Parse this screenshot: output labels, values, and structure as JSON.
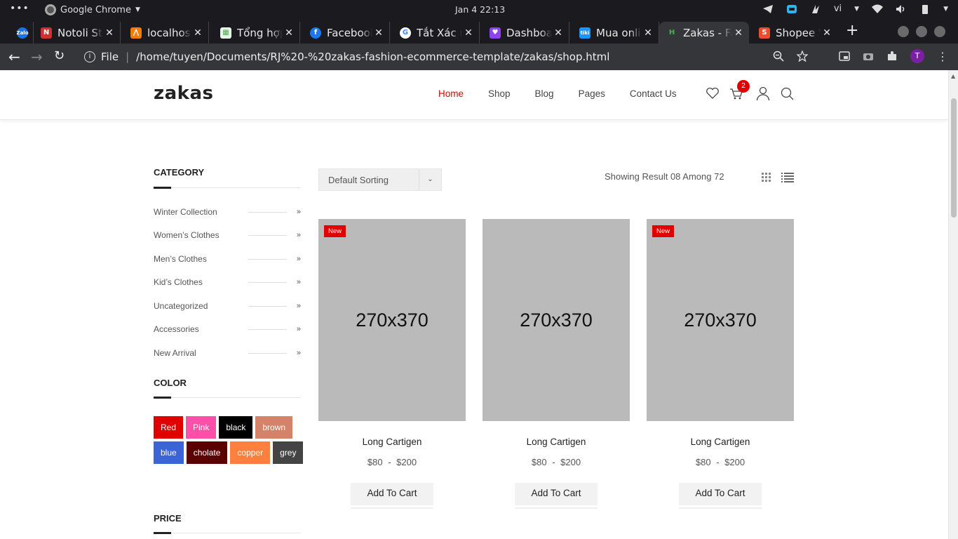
{
  "os": {
    "app_name": "Google Chrome",
    "clock": "Jan 4  22:13",
    "keyboard": "vi"
  },
  "tabs": [
    {
      "title": "",
      "favicon": "zalo-icon",
      "color": "#1a73e8"
    },
    {
      "title": "Notoli St",
      "favicon": "N",
      "color": "#d32f2f"
    },
    {
      "title": "localhost",
      "favicon": "xampp-icon",
      "color": "#f57c00"
    },
    {
      "title": "Tổng hợp",
      "favicon": "calendar-icon",
      "color": "#4caf50"
    },
    {
      "title": "Facebook",
      "favicon": "f",
      "color": "#1877f2"
    },
    {
      "title": "Tắt Xác n",
      "favicon": "G",
      "color": "#ffffff"
    },
    {
      "title": "Dashboa",
      "favicon": "heart-icon",
      "color": "#8e44ec"
    },
    {
      "title": "Mua onli",
      "favicon": "tiki",
      "color": "#1a94ff"
    },
    {
      "title": "Zakas - Fa",
      "favicon": "H",
      "color": "#35363a"
    },
    {
      "title": "Shopee V",
      "favicon": "S",
      "color": "#ee4d2d"
    }
  ],
  "address": {
    "scheme": "File",
    "url": "/home/tuyen/Documents/RJ%20-%20zakas-fashion-ecommerce-template/zakas/shop.html",
    "profile_initial": "T"
  },
  "site": {
    "logo": "zakas",
    "nav": [
      "Home",
      "Shop",
      "Blog",
      "Pages",
      "Contact Us"
    ],
    "cart_count": "2"
  },
  "sidebar": {
    "category_title": "CATEGORY",
    "categories": [
      "Winter Collection",
      "Women’s Clothes",
      "Men’s Clothes",
      "Kid’s Clothes",
      "Uncategorized",
      "Accessories",
      "New Arrival"
    ],
    "color_title": "COLOR",
    "colors": [
      {
        "label": "Red",
        "bg": "#e00000"
      },
      {
        "label": "Pink",
        "bg": "#ff4fa8"
      },
      {
        "label": "black",
        "bg": "#000000"
      },
      {
        "label": "brown",
        "bg": "#d4826a"
      },
      {
        "label": "blue",
        "bg": "#3b64d6"
      },
      {
        "label": "cholate",
        "bg": "#5a0000"
      },
      {
        "label": "copper",
        "bg": "#ff7f3f"
      },
      {
        "label": "grey",
        "bg": "#444444"
      }
    ],
    "price_title": "PRICE"
  },
  "shop": {
    "sort_label": "Default Sorting",
    "result_text": "Showing Result 08 Among 72",
    "products": [
      {
        "image_text": "270x370",
        "badge": "New",
        "name": "Long Cartigen",
        "price": "$80 - $200",
        "button": "Add To Cart"
      },
      {
        "image_text": "270x370",
        "badge": "",
        "name": "Long Cartigen",
        "price": "$80 - $200",
        "button": "Add To Cart"
      },
      {
        "image_text": "270x370",
        "badge": "New",
        "name": "Long Cartigen",
        "price": "$80 - $200",
        "button": "Add To Cart"
      }
    ]
  }
}
